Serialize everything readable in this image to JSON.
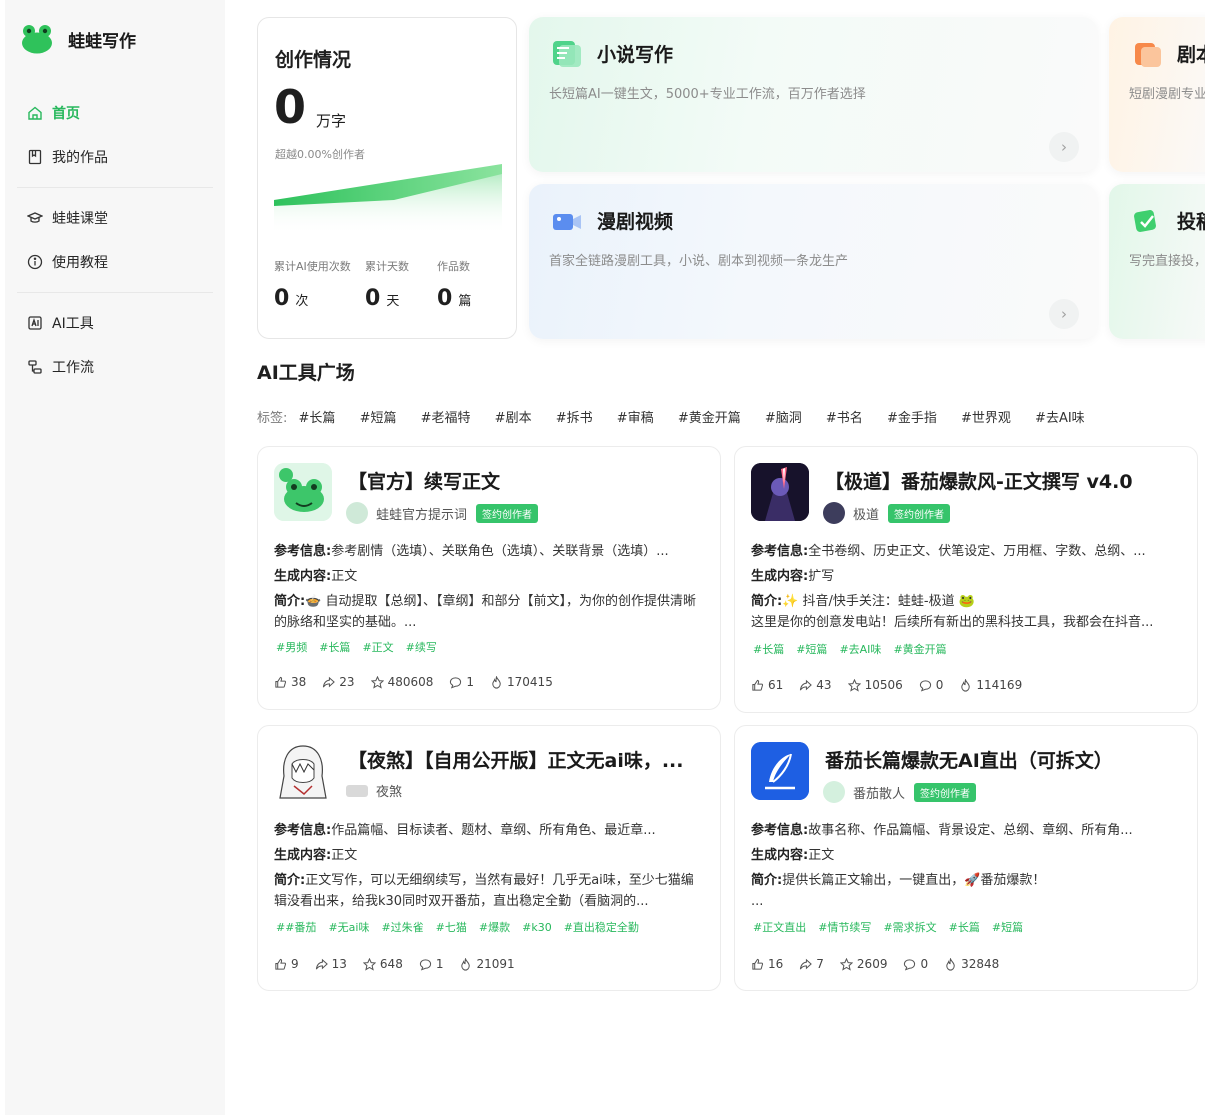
{
  "app": {
    "name": "蛙蛙写作"
  },
  "sidebar": {
    "items": [
      {
        "label": "首页",
        "icon": "home-icon",
        "active": true
      },
      {
        "label": "我的作品",
        "icon": "book-icon"
      },
      {
        "label": "蛙蛙课堂",
        "icon": "graduation-cap-icon"
      },
      {
        "label": "使用教程",
        "icon": "info-circle-icon"
      },
      {
        "label": "AI工具",
        "icon": "ai-tool-icon"
      },
      {
        "label": "工作流",
        "icon": "workflow-icon"
      }
    ]
  },
  "stats": {
    "title": "创作情况",
    "words_value": "0",
    "words_unit": "万字",
    "exceed_text": "超越0.00%创作者",
    "metrics": [
      {
        "label": "累计AI使用次数",
        "value": "0",
        "unit": "次"
      },
      {
        "label": "累计天数",
        "value": "0",
        "unit": "天"
      },
      {
        "label": "作品数",
        "value": "0",
        "unit": "篇"
      }
    ]
  },
  "features": [
    {
      "title": "小说写作",
      "desc": "长短篇AI一键生文，5000+专业工作流，百万作者选择"
    },
    {
      "title": "漫剧视频",
      "desc": "首家全链路漫剧工具，小说、剧本到视频一条龙生产"
    },
    {
      "title": "剧本",
      "desc": "短剧漫剧专业"
    },
    {
      "title": "投稿",
      "desc": "写完直接投，"
    }
  ],
  "tools_section": {
    "title": "AI工具广场",
    "tags_label": "标签:",
    "tags": [
      "#长篇",
      "#短篇",
      "#老福特",
      "#剧本",
      "#拆书",
      "#审稿",
      "#黄金开篇",
      "#脑洞",
      "#书名",
      "#金手指",
      "#世界观",
      "#去AI味"
    ]
  },
  "labels": {
    "ref": "参考信息:",
    "gen": "生成内容:",
    "intro": "简介:",
    "badge": "签约创作者"
  },
  "cards": [
    {
      "title": "【官方】续写正文",
      "author": "蛙蛙官方提示词",
      "badge": true,
      "ref": "参考剧情（选填）、关联角色（选填）、关联背景（选填）...",
      "gen": "正文",
      "intro": "🍲 自动提取【总纲】、【章纲】和部分【前文】，为你的创作提供清晰的脉络和坚实的基础。...",
      "tags": [
        "#男频",
        "#长篇",
        "#正文",
        "#续写"
      ],
      "likes": "38",
      "shares": "23",
      "stars": "480608",
      "comments": "1",
      "hot": "170415"
    },
    {
      "title": "【极道】番茄爆款风-正文撰写 v4.0",
      "author": "极道",
      "badge": true,
      "ref": "全书卷纲、历史正文、伏笔设定、万用框、字数、总纲、...",
      "gen": "扩写",
      "intro": "✨ 抖音/快手关注：蛙蛙-极道 🐸\n这里是你的创意发电站！后续所有新出的黑科技工具，我都会在抖音...",
      "tags": [
        "#长篇",
        "#短篇",
        "#去AI味",
        "#黄金开篇"
      ],
      "likes": "61",
      "shares": "43",
      "stars": "10506",
      "comments": "0",
      "hot": "114169"
    },
    {
      "title": "【夜煞】【自用公开版】正文无ai味，...",
      "author": "夜煞",
      "badge": false,
      "ref": "作品篇幅、目标读者、题材、章纲、所有角色、最近章...",
      "gen": "正文",
      "intro": "正文写作，可以无细纲续写，当然有最好！几乎无ai味，至少七猫编辑没看出来，给我k30同时双开番茄，直出稳定全勤（看脑洞的...",
      "tags": [
        "##番茄",
        "#无ai味",
        "#过朱雀",
        "#七猫",
        "#爆款",
        "#k30",
        "#直出稳定全勤"
      ],
      "likes": "9",
      "shares": "13",
      "stars": "648",
      "comments": "1",
      "hot": "21091"
    },
    {
      "title": "番茄长篇爆款无AI直出（可拆文）",
      "author": "番茄散人",
      "badge": true,
      "ref": "故事名称、作品篇幅、背景设定、总纲、章纲、所有角...",
      "gen": "正文",
      "intro": "提供长篇正文输出，一键直出，🚀番茄爆款！\n...",
      "tags": [
        "#正文直出",
        "#情节续写",
        "#需求拆文",
        "#长篇",
        "#短篇"
      ],
      "likes": "16",
      "shares": "7",
      "stars": "2609",
      "comments": "0",
      "hot": "32848"
    }
  ]
}
